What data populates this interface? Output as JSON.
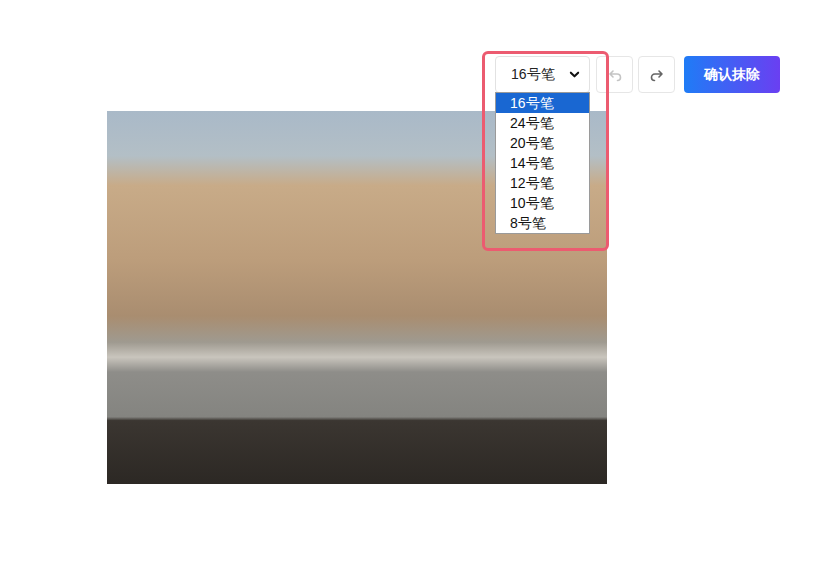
{
  "brush_select": {
    "value": "16号笔",
    "expanded": true,
    "options": [
      {
        "label": "16号笔",
        "selected": true
      },
      {
        "label": "24号笔",
        "selected": false
      },
      {
        "label": "20号笔",
        "selected": false
      },
      {
        "label": "14号笔",
        "selected": false
      },
      {
        "label": "12号笔",
        "selected": false
      },
      {
        "label": "10号笔",
        "selected": false
      },
      {
        "label": "8号笔",
        "selected": false
      }
    ]
  },
  "history_buttons": [
    {
      "kind": "undo",
      "disabled": true
    },
    {
      "kind": "redo",
      "disabled": false
    }
  ],
  "confirm_button": {
    "label": "确认抹除"
  }
}
